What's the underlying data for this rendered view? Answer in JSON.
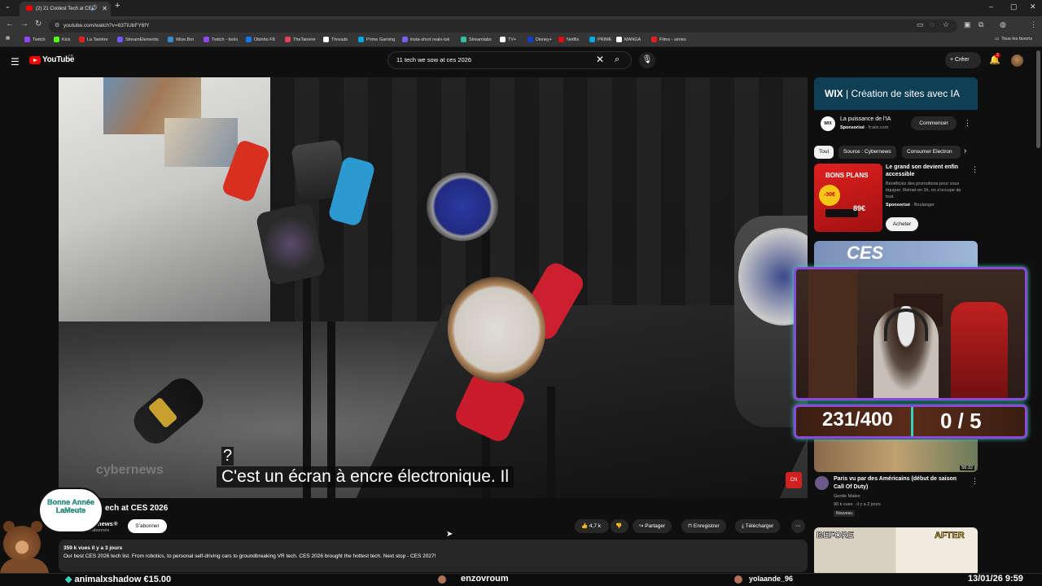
{
  "browser": {
    "tab_title": "(2) 21 Coolest Tech at CES",
    "new_tab": "+",
    "url": "youtube.com/watch?v=83TiUbFY6fY",
    "window_controls": [
      "–",
      "▢",
      "✕"
    ],
    "bookmarks": [
      {
        "label": "Twitch",
        "color": "#9146ff"
      },
      {
        "label": "Kick",
        "color": "#53fc18"
      },
      {
        "label": "La Tanière",
        "color": "#e02020"
      },
      {
        "label": "StreamElements",
        "color": "#6a5cff"
      },
      {
        "label": "Wize.Bot",
        "color": "#3a8ad0"
      },
      {
        "label": "Twitch - tools",
        "color": "#9146ff"
      },
      {
        "label": "Obinho F8",
        "color": "#1877f2"
      },
      {
        "label": "TheTaniere",
        "color": "#e4405f"
      },
      {
        "label": "Threads",
        "color": "#ffffff"
      },
      {
        "label": "Prime Gaming",
        "color": "#00a8e1"
      },
      {
        "label": "insta-short reals-tok",
        "color": "#7a5cff"
      },
      {
        "label": "Streamlabs",
        "color": "#31c3a2"
      },
      {
        "label": "TV+",
        "color": "#ffffff"
      },
      {
        "label": "Disney+",
        "color": "#113ccf"
      },
      {
        "label": "Netflix",
        "color": "#e50914"
      },
      {
        "label": "PRIME",
        "color": "#00a8e1"
      },
      {
        "label": "MANGA",
        "color": "#ffffff"
      },
      {
        "label": "Films - séries",
        "color": "#e02020"
      }
    ],
    "all_favorites": "Tous les favoris"
  },
  "youtube": {
    "logo_text": "YouTube",
    "region": "FR",
    "search_value": "11 tech we sow  at ces 2026",
    "create_label": "Créer",
    "notif_count": "2"
  },
  "video": {
    "watermark": "cybernews",
    "subtitle_q": "?",
    "subtitle_main": "C'est un écran à encre électronique.  Il",
    "title": "ech at CES 2026",
    "channel": "news",
    "channel_subs": "618 k abonnés",
    "subscribe": "S'abonner",
    "likes": "4,7 k",
    "share": "Partager",
    "save": "Enregistrer",
    "download": "Télécharger",
    "meta": "359 k vues  il y a 3 jours",
    "description": "Our best CES 2026 tech list. From robotics, to personal self-driving cars to groundbreaking VR tech. CES 2026 brought the hottest tech. Next stop - CES 2027!"
  },
  "sidebar": {
    "ad1": {
      "banner": "Création de sites avec IA",
      "brand": "WIX",
      "title": "La puissance de l'IA",
      "sponsored": "Sponsorisé",
      "domain": "· fr.wix.com",
      "cta": "Commencer"
    },
    "chips": [
      "Tout",
      "Source : Cybernews",
      "Consumer Electron"
    ],
    "ad2": {
      "thumb_headline": "BONS PLANS",
      "thumb_discount": "-30€",
      "thumb_price": "89€",
      "title": "Le grand son devient enfin accessible",
      "desc": "Bénéficiez des promotions pour vous équiper. Retrait en 1h, on s'occupe de tout.",
      "sponsored": "Sponsorisé",
      "advertiser": "· Boulanger",
      "cta": "Acheter"
    },
    "ces_thumb": "CES",
    "video2": {
      "duration": "56:32",
      "title": "Paris vu par des Américains (début de saison Call Of Duty)",
      "channel": "Gentle Mates",
      "meta": "90 k vues · il y a 2 jours",
      "badge": "Nouveau"
    },
    "before": "BEFORE",
    "after": "AFTER"
  },
  "overlay": {
    "count_left": "231/400",
    "count_right": "0 / 5",
    "bubble_text": "Bonne Année LaMeute",
    "ticker_1": "animalxshadow €15.00",
    "ticker_2": "enzovroum",
    "ticker_3": "yolaande_96",
    "datetime": "13/01/26  9:59"
  }
}
